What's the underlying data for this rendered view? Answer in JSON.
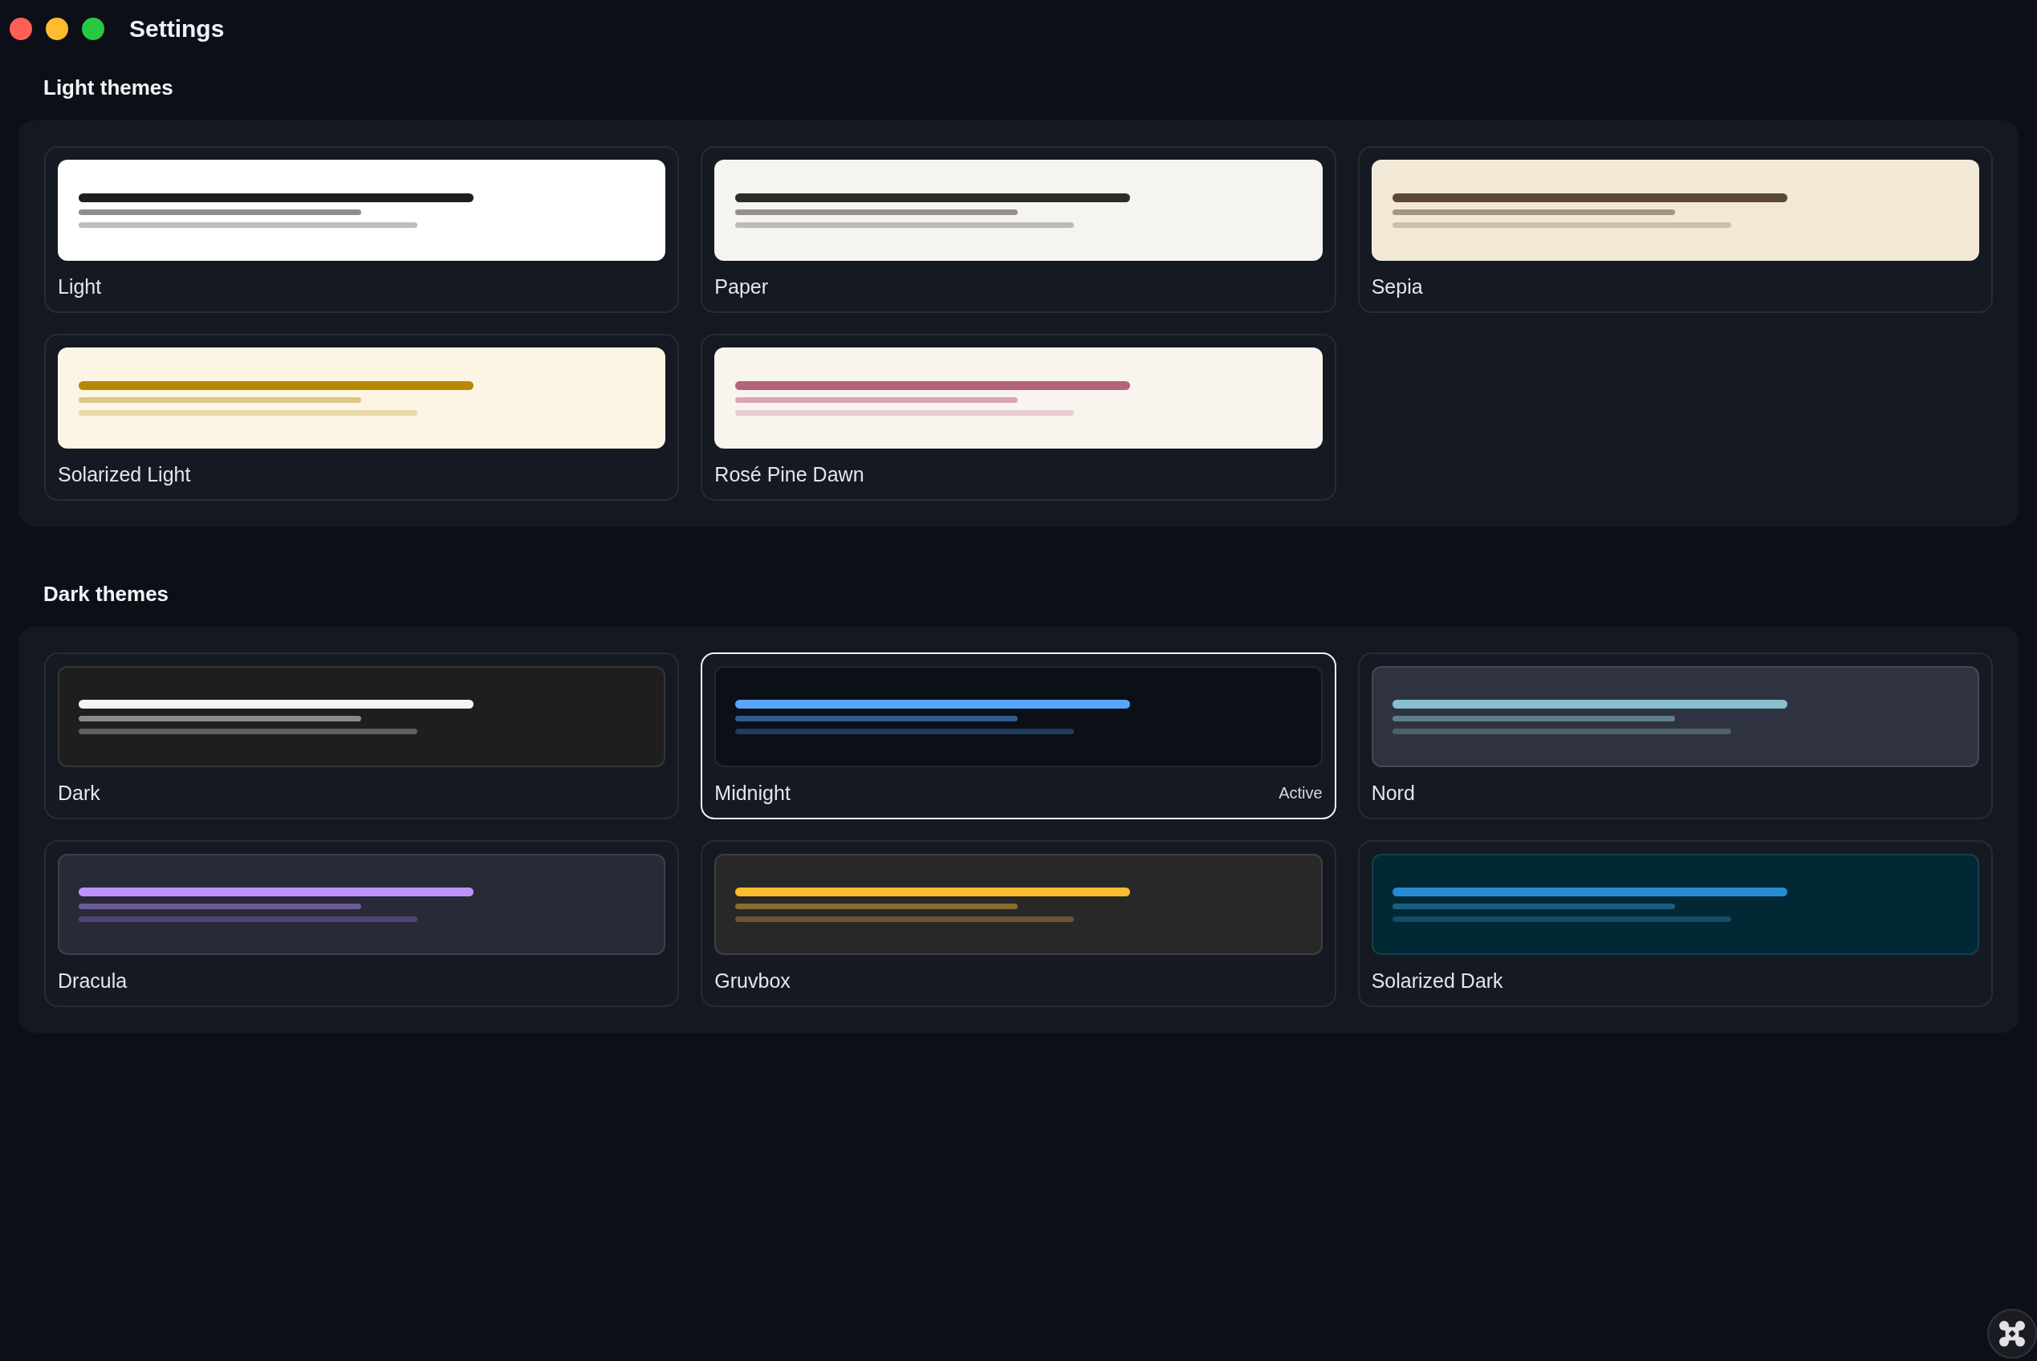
{
  "window": {
    "title": "Settings"
  },
  "sections": [
    {
      "title": "Light themes",
      "themes": [
        {
          "name": "Light",
          "selected": false,
          "preview": {
            "color": "#ffffff",
            "lines": [
              {
                "color": "#1f1f1f"
              },
              {
                "color": "#8e8e8e"
              },
              {
                "color": "#bdbdbd"
              }
            ]
          }
        },
        {
          "name": "Paper",
          "selected": false,
          "preview": {
            "color": "#f5f4ee",
            "lines": [
              {
                "color": "#2d2b27"
              },
              {
                "color": "#93918a"
              },
              {
                "color": "#bdbcb6"
              }
            ]
          }
        },
        {
          "name": "Sepia",
          "selected": false,
          "preview": {
            "color": "#f2e8d6",
            "lines": [
              {
                "color": "#5c4838"
              },
              {
                "color": "#a69580"
              },
              {
                "color": "#cdbfa8"
              }
            ]
          }
        },
        {
          "name": "Solarized Light",
          "selected": false,
          "preview": {
            "color": "#fdf5e4",
            "lines": [
              {
                "color": "#b58900"
              },
              {
                "color": "#dcc683"
              },
              {
                "color": "#e8d8a8"
              }
            ]
          }
        },
        {
          "name": "Rosé Pine Dawn",
          "selected": false,
          "preview": {
            "color": "#faf4ee",
            "lines": [
              {
                "color": "#b4637a"
              },
              {
                "color": "#d9a6b2"
              },
              {
                "color": "#eacbd0"
              }
            ]
          }
        }
      ]
    },
    {
      "title": "Dark themes",
      "themes": [
        {
          "name": "Dark",
          "selected": false,
          "preview": {
            "color": "#1e1e1f",
            "lines": [
              {
                "color": "#f5f5f5"
              },
              {
                "color": "#8a8a8a"
              },
              {
                "color": "#5f5f5f"
              }
            ]
          }
        },
        {
          "name": "Midnight",
          "selected": true,
          "badge": "Active",
          "preview": {
            "color": "#0b0f17",
            "lines": [
              {
                "color": "#58a6ff"
              },
              {
                "color": "#2f5b8f"
              },
              {
                "color": "#213c5f"
              }
            ]
          }
        },
        {
          "name": "Nord",
          "selected": false,
          "preview": {
            "color": "#2f3341",
            "lines": [
              {
                "color": "#88c0d0"
              },
              {
                "color": "#5e7f88"
              },
              {
                "color": "#4c6168"
              }
            ]
          }
        },
        {
          "name": "Dracula",
          "selected": false,
          "preview": {
            "color": "#292a38",
            "lines": [
              {
                "color": "#bd93f9"
              },
              {
                "color": "#6d5a97"
              },
              {
                "color": "#4f4573"
              }
            ]
          }
        },
        {
          "name": "Gruvbox",
          "selected": false,
          "preview": {
            "color": "#282828",
            "lines": [
              {
                "color": "#fabd2f"
              },
              {
                "color": "#8a6c2e"
              },
              {
                "color": "#6b5631"
              }
            ]
          }
        },
        {
          "name": "Solarized Dark",
          "selected": false,
          "preview": {
            "color": "#012935",
            "lines": [
              {
                "color": "#268bd2"
              },
              {
                "color": "#1a5d82"
              },
              {
                "color": "#154a68"
              }
            ]
          }
        }
      ]
    }
  ]
}
